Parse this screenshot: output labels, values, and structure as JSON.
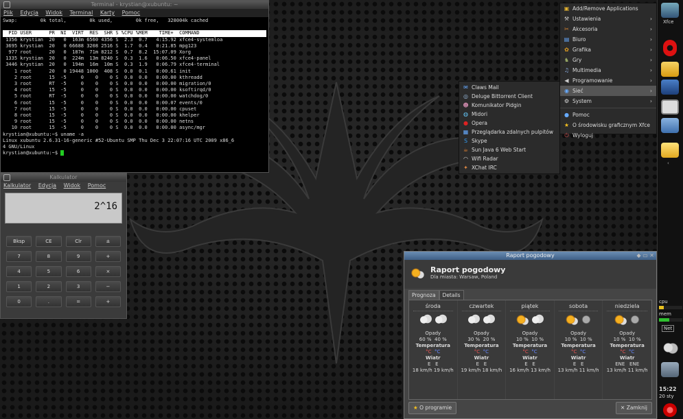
{
  "terminal": {
    "title": "Terminal - krystian@xubuntu: ~",
    "menu": [
      "Plik",
      "Edycja",
      "Widok",
      "Terminal",
      "Karty",
      "Pomoc"
    ],
    "swap_line": "Swap:        0k total,        0k used,        0k free,   328004k cached",
    "header": "  PID USER      PR  NI  VIRT  RES  SHR S %CPU %MEM    TIME+  COMMAND            ",
    "rows": [
      " 1356 krystian  20   0  163m 6560 4356 S  2.3  0.7   4:15.92 xfce4-systemloa",
      " 3695 krystian  20   0 66688 3208 2516 S  1.7  0.4   0:21.85 mpg123",
      "  977 root      20   0  187m  71m 8212 S  0.7  8.2  15:07.09 Xorg",
      " 1335 krystian  20   0  224m  13m 8240 S  0.3  1.6   0:06.50 xfce4-panel",
      " 3446 krystian  20   0  194m  16m  10m S  0.3  1.9   0:06.79 xfce4-terminal",
      "    1 root      20   0 19448 1000  408 S  0.0  0.1   0:00.61 init",
      "    2 root      15  -5     0    0    0 S  0.0  0.0   0:00.00 kthreadd",
      "    3 root      RT  -5     0    0    0 S  0.0  0.0   0:00.00 migration/0",
      "    4 root      15  -5     0    0    0 S  0.0  0.0   0:00.00 ksoftirqd/0",
      "    5 root      RT  -5     0    0    0 S  0.0  0.0   0:00.00 watchdog/0",
      "    6 root      15  -5     0    0    0 S  0.0  0.0   0:00.07 events/0",
      "    7 root      15  -5     0    0    0 S  0.0  0.0   0:00.00 cpuset",
      "    8 root      15  -5     0    0    0 S  0.0  0.0   0:00.00 khelper",
      "    9 root      15  -5     0    0    0 S  0.0  0.0   0:00.00 netns",
      "   10 root      15  -5     0    0    0 S  0.0  0.0   0:00.00 async/mgr"
    ],
    "cmd1": "krystian@xubuntu:~$ uname -a",
    "uname1": "Linux xubuntu 2.6.31-16-generic #52-Ubuntu SMP Thu Dec 3 22:07:16 UTC 2009 x86_6",
    "uname2": "4 GNU/Linux",
    "prompt": "krystian@xubuntu:~$ "
  },
  "calculator": {
    "title": "Kalkulator",
    "menu": [
      "Kalkulator",
      "Edycja",
      "Widok",
      "Pomoc"
    ],
    "display": "2^16",
    "keys": [
      "Bksp",
      "CE",
      "Clr",
      "±",
      "7",
      "8",
      "9",
      "+",
      "4",
      "5",
      "6",
      "×",
      "1",
      "2",
      "3",
      "−",
      "0",
      ".",
      "=",
      "+"
    ]
  },
  "appmenu": {
    "items": [
      {
        "icon": "add",
        "label": "Add/Remove Applications",
        "sub": false
      },
      {
        "icon": "wrench",
        "label": "Ustawienia",
        "sub": true
      },
      {
        "icon": "tools",
        "label": "Akcesoria",
        "sub": true
      },
      {
        "icon": "office",
        "label": "Biuro",
        "sub": true
      },
      {
        "icon": "graphics",
        "label": "Grafika",
        "sub": true
      },
      {
        "icon": "games",
        "label": "Gry",
        "sub": true
      },
      {
        "icon": "media",
        "label": "Multimedia",
        "sub": true
      },
      {
        "icon": "dev",
        "label": "Programowanie",
        "sub": true
      },
      {
        "icon": "net",
        "label": "Sieć",
        "sub": true
      },
      {
        "icon": "system",
        "label": "System",
        "sub": true
      }
    ],
    "items2": [
      {
        "icon": "help",
        "label": "Pomoc"
      },
      {
        "icon": "star",
        "label": "O środowisku graficznym Xfce"
      },
      {
        "icon": "logout",
        "label": "Wyloguj"
      }
    ]
  },
  "submenu": {
    "items": [
      "Claws Mail",
      "Deluge Bittorrent Client",
      "Komunikator Pidgin",
      "Midori",
      "Opera",
      "Przeglądarka zdalnych pulpitów",
      "Skype",
      "Sun Java 6 Web Start",
      "Wifi Radar",
      "XChat IRC"
    ]
  },
  "panel": {
    "xfce_label": "Xfce",
    "cpu": "cpu",
    "mem": "mem",
    "net": "Net",
    "time": "15:22",
    "date": "20 sty"
  },
  "weather": {
    "window_title": "Raport pogodowy",
    "title": "Raport pogodowy",
    "subtitle": "Dla miasta: Warsaw, Poland",
    "tabs": [
      "Prognoza",
      "Details"
    ],
    "days": [
      {
        "name": "środa",
        "icons": [
          "cloud",
          "cloud"
        ],
        "opady": "Opady",
        "p1": "60 %",
        "p2": "40 %",
        "temp": "Temperatura",
        "t1": "°C",
        "t2": "°C",
        "wiatr": "Wiatr",
        "d1": "E",
        "d2": "E",
        "s1": "18 km/h",
        "s2": "19 km/h"
      },
      {
        "name": "czwartek",
        "icons": [
          "cloud",
          "cloud"
        ],
        "opady": "Opady",
        "p1": "30 %",
        "p2": "20 %",
        "temp": "Temperatura",
        "t1": "°C",
        "t2": "°C",
        "wiatr": "Wiatr",
        "d1": "E",
        "d2": "E",
        "s1": "19 km/h",
        "s2": "18 km/h"
      },
      {
        "name": "piątek",
        "icons": [
          "sun",
          "cloud"
        ],
        "opady": "Opady",
        "p1": "10 %",
        "p2": "10 %",
        "temp": "Temperatura",
        "t1": "°C",
        "t2": "°C",
        "wiatr": "Wiatr",
        "d1": "E",
        "d2": "E",
        "s1": "16 km/h",
        "s2": "13 km/h"
      },
      {
        "name": "sobota",
        "icons": [
          "sun",
          "moon"
        ],
        "opady": "Opady",
        "p1": "10 %",
        "p2": "10 %",
        "temp": "Temperatura",
        "t1": "°C",
        "t2": "°C",
        "wiatr": "Wiatr",
        "d1": "E",
        "d2": "E",
        "s1": "13 km/h",
        "s2": "11 km/h"
      },
      {
        "name": "niedziela",
        "icons": [
          "sun",
          "moon"
        ],
        "opady": "Opady",
        "p1": "10 %",
        "p2": "10 %",
        "temp": "Temperatura",
        "t1": "°C",
        "t2": "°C",
        "wiatr": "Wiatr",
        "d1": "ENE",
        "d2": "ENE",
        "s1": "13 km/h",
        "s2": "11 km/h"
      }
    ],
    "about_button": "O programie",
    "close_button": "Zamknij"
  }
}
